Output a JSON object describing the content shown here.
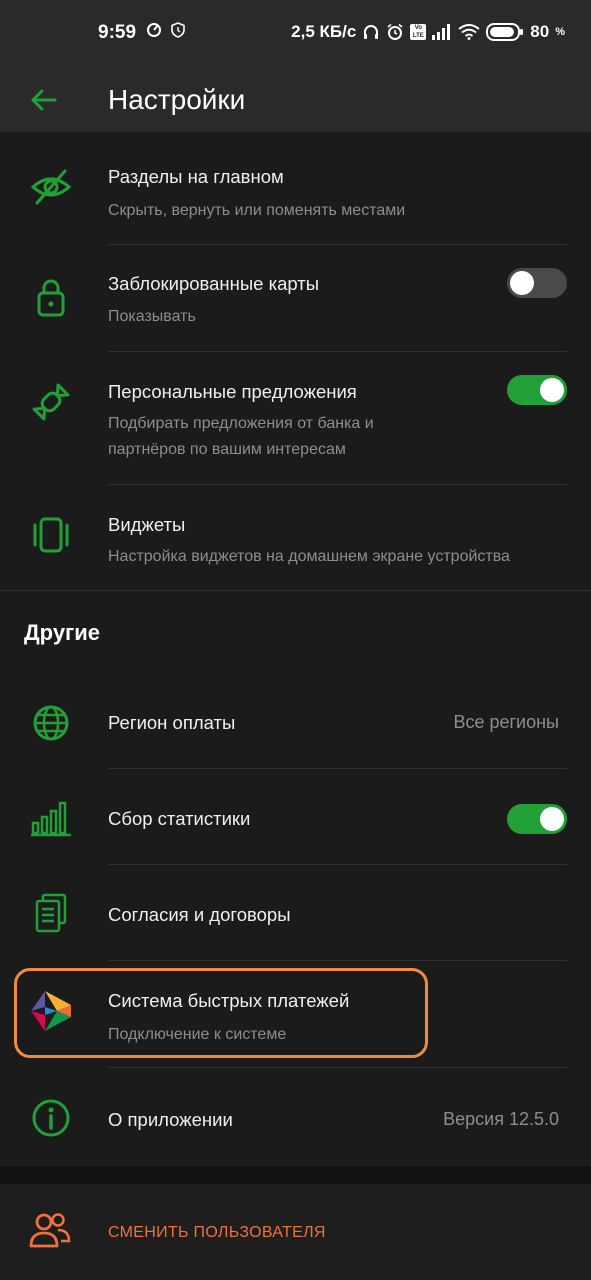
{
  "status_bar": {
    "time": "9:59",
    "speed": "2,5 КБ/с",
    "battery": "80",
    "battery_unit": "%",
    "volte": "VoLTE"
  },
  "header": {
    "title": "Настройки",
    "back_icon": "arrow-left-icon"
  },
  "settings": [
    {
      "title": "Разделы на главном",
      "subtitle": "Скрыть, вернуть или поменять местами",
      "icon": "eye-off-icon"
    },
    {
      "title": "Заблокированные карты",
      "subtitle": "Показывать",
      "icon": "lock-icon",
      "toggle": false
    },
    {
      "title": "Персональные предложения",
      "subtitle": "Подбирать предложения от банка и партнёров по вашим интересам",
      "icon": "candy-icon",
      "toggle": true
    },
    {
      "title": "Виджеты",
      "subtitle": "Настройка виджетов на домашнем экране устройства",
      "icon": "widgets-icon"
    }
  ],
  "other_section": {
    "title": "Другие",
    "items": [
      {
        "title": "Регион оплаты",
        "value": "Все регионы",
        "icon": "globe-icon"
      },
      {
        "title": "Сбор статистики",
        "icon": "stats-icon",
        "toggle": true
      },
      {
        "title": "Согласия и договоры",
        "icon": "documents-icon"
      },
      {
        "title": "Система быстрых платежей",
        "subtitle": "Подключение к системе",
        "icon": "sbp-logo-icon"
      },
      {
        "title": "О приложении",
        "value": "Версия 12.5.0",
        "icon": "info-icon"
      }
    ]
  },
  "logout": {
    "label": "СМЕНИТЬ ПОЛЬЗОВАТЕЛЯ",
    "icon": "users-icon"
  },
  "colors": {
    "accent": "#21a038",
    "highlight": "#f28a3f",
    "logout": "#f0713b",
    "background": "#1b1b1b"
  }
}
